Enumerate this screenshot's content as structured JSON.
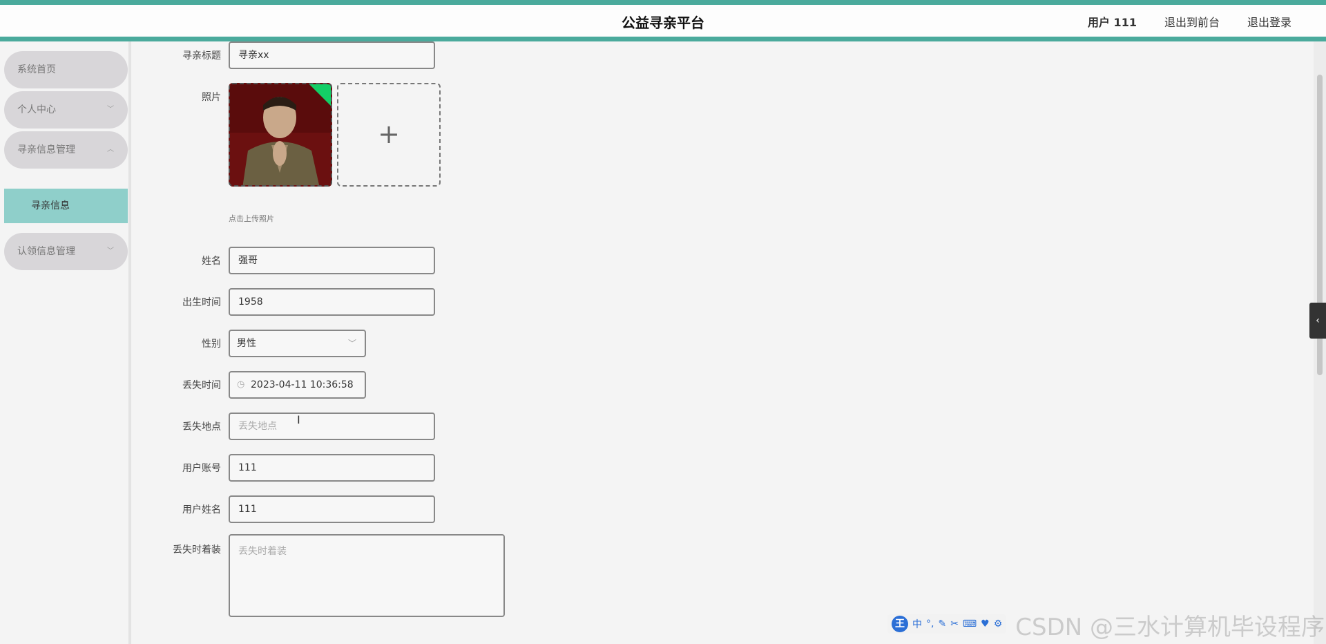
{
  "header": {
    "title": "公益寻亲平台",
    "user": "用户 111",
    "back_front": "退出到前台",
    "logout": "退出登录"
  },
  "sidebar": {
    "items": [
      {
        "label": "系统首页"
      },
      {
        "label": "个人中心"
      },
      {
        "label": "寻亲信息管理"
      },
      {
        "label": "认领信息管理"
      }
    ],
    "sub_active": "寻亲信息"
  },
  "form": {
    "title_label": "寻亲标题",
    "title_value": "寻亲xx",
    "photo_label": "照片",
    "upload_hint": "点击上传照片",
    "name_label": "姓名",
    "name_value": "强哥",
    "birth_label": "出生时间",
    "birth_value": "1958",
    "gender_label": "性别",
    "gender_value": "男性",
    "lost_time_label": "丢失时间",
    "lost_time_value": "2023-04-11 10:36:58",
    "lost_place_label": "丢失地点",
    "lost_place_placeholder": "丢失地点",
    "account_label": "用户账号",
    "account_value": "111",
    "username_label": "用户姓名",
    "username_value": "111",
    "clothes_label": "丢失时着装",
    "clothes_placeholder": "丢失时着装"
  },
  "overlay": {
    "ime_logo": "王",
    "ime_mode": "中",
    "watermark": "CSDN @三水计算机毕设程序"
  }
}
